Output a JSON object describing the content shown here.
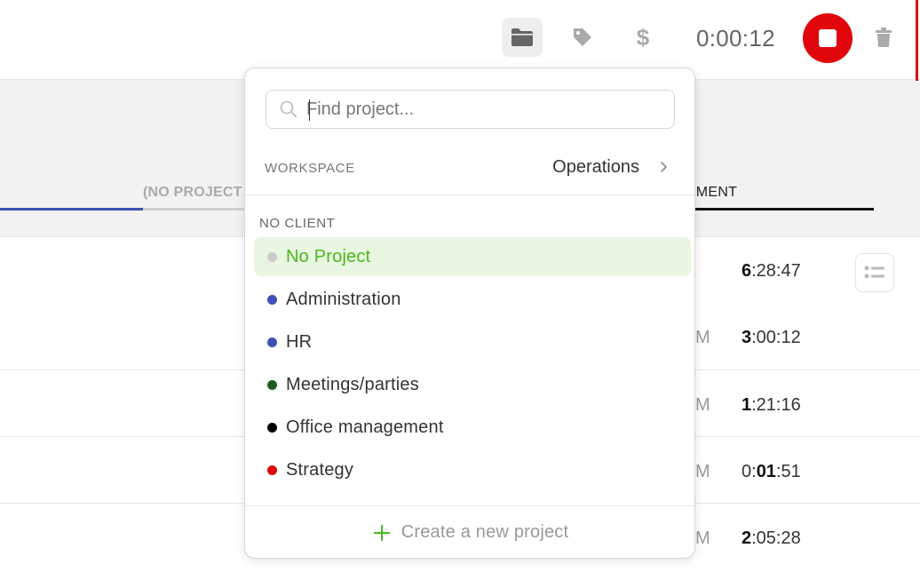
{
  "toolbar": {
    "timer": "0:00:12",
    "project_icon": "folder-icon",
    "tag_icon": "tag-icon",
    "billable_icon": "dollar-icon",
    "stop_icon": "stop-icon",
    "delete_icon": "trash-icon"
  },
  "tabs": {
    "left_label": "(NO PROJECT",
    "right_label": "GEMENT"
  },
  "rows": [
    {
      "ampm": "",
      "dur_bold": "6",
      "dur_rest": ":28:47"
    },
    {
      "ampm": "M",
      "dur_bold": "3",
      "dur_rest": ":00:12"
    },
    {
      "ampm": "M",
      "dur_bold": "1",
      "dur_rest": ":21:16"
    },
    {
      "ampm": "M",
      "dur_pre": "0:",
      "dur_bold": "01",
      "dur_rest": ":51"
    },
    {
      "ampm": "M",
      "dur_bold": "2",
      "dur_rest": ":05:28"
    }
  ],
  "dropdown": {
    "search_placeholder": "Find project...",
    "workspace_label": "WORKSPACE",
    "workspace_value": "Operations",
    "client_label": "NO CLIENT",
    "projects": [
      {
        "name": "No Project",
        "color": "#cccccc",
        "selected": true
      },
      {
        "name": "Administration",
        "color": "#3f51b5",
        "selected": false
      },
      {
        "name": "HR",
        "color": "#3f51b5",
        "selected": false
      },
      {
        "name": "Meetings/parties",
        "color": "#1b5e20",
        "selected": false
      },
      {
        "name": "Office management",
        "color": "#000000",
        "selected": false
      },
      {
        "name": "Strategy",
        "color": "#e0060b",
        "selected": false
      }
    ],
    "create_label": "Create a new project"
  },
  "colors": {
    "accent_green": "#4bb81d",
    "stop_red": "#e0060b",
    "tab_blue": "#3f51b5"
  }
}
